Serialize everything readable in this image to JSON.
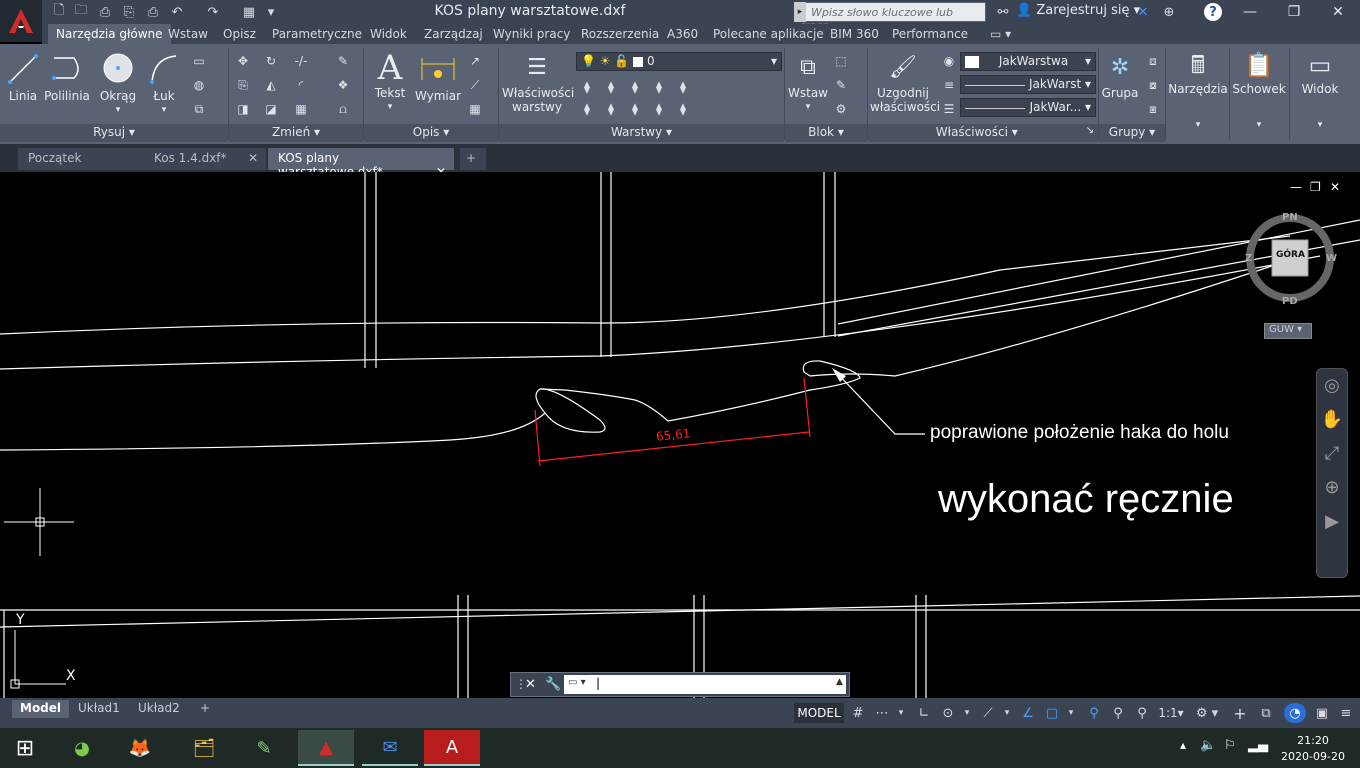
{
  "title_bar": {
    "window_title": "KOS plany warsztatowe.dxf",
    "search_placeholder": "Wpisz słowo kluczowe lub frazę",
    "signin_label": "Zarejestruj się",
    "help_label": "?",
    "app_icon": "autocad-a-icon"
  },
  "ribbon_tabs": [
    "Narzędzia główne",
    "Wstaw",
    "Opisz",
    "Parametryczne",
    "Widok",
    "Zarządzaj",
    "Wyniki pracy",
    "Rozszerzenia",
    "A360",
    "Polecane aplikacje",
    "BIM 360",
    "Performance"
  ],
  "ribbon": {
    "draw": {
      "title": "Rysuj",
      "line": "Linia",
      "polyline": "Polilinia",
      "circle": "Okrąg",
      "arc": "Łuk"
    },
    "modify": {
      "title": "Zmień"
    },
    "annotation": {
      "title": "Opis",
      "text": "Tekst",
      "dimension": "Wymiar"
    },
    "layers": {
      "title": "Warstwy",
      "properties_line1": "Właściwości",
      "properties_line2": "warstwy",
      "current_layer": "0"
    },
    "block": {
      "title": "Blok",
      "insert": "Wstaw"
    },
    "properties": {
      "title": "Właściwości",
      "match_line1": "Uzgodnij",
      "match_line2": "właściwości",
      "color": "JakWarstwa",
      "linetype": "JakWarst",
      "lineweight": "JakWar..."
    },
    "groups": {
      "title": "Grupy",
      "group": "Grupa"
    },
    "tools": {
      "title": "Narzędzia"
    },
    "clipboard": {
      "title": "Schowek"
    },
    "view": {
      "title": "Widok"
    }
  },
  "doc_tabs": [
    "Początek",
    "Kos 1.4.dxf*",
    "KOS plany warsztatowe.dxf*"
  ],
  "drawing": {
    "dimension_value": "65,61",
    "leader_note": "poprawione położenie haka do holu",
    "big_note": "wykonać ręcznie",
    "viewcube": {
      "top": "GÓRA",
      "north": "PN",
      "south": "PD",
      "west": "Z",
      "east": "W",
      "wcs": "GUW"
    },
    "ucs_x": "X",
    "ucs_y": "Y"
  },
  "layout_tabs": [
    "Model",
    "Układ1",
    "Układ2"
  ],
  "status": {
    "model": "MODEL",
    "scale": "1:1"
  },
  "clock": {
    "time": "21:20",
    "date": "2020-09-20"
  },
  "colors": {
    "ribbon_bg": "#5a6373",
    "titlebar_bg": "#3b4453",
    "dimension_red": "#ff2020",
    "geometry": "#ffffff",
    "taskbar_bg": "#1f2a26"
  }
}
